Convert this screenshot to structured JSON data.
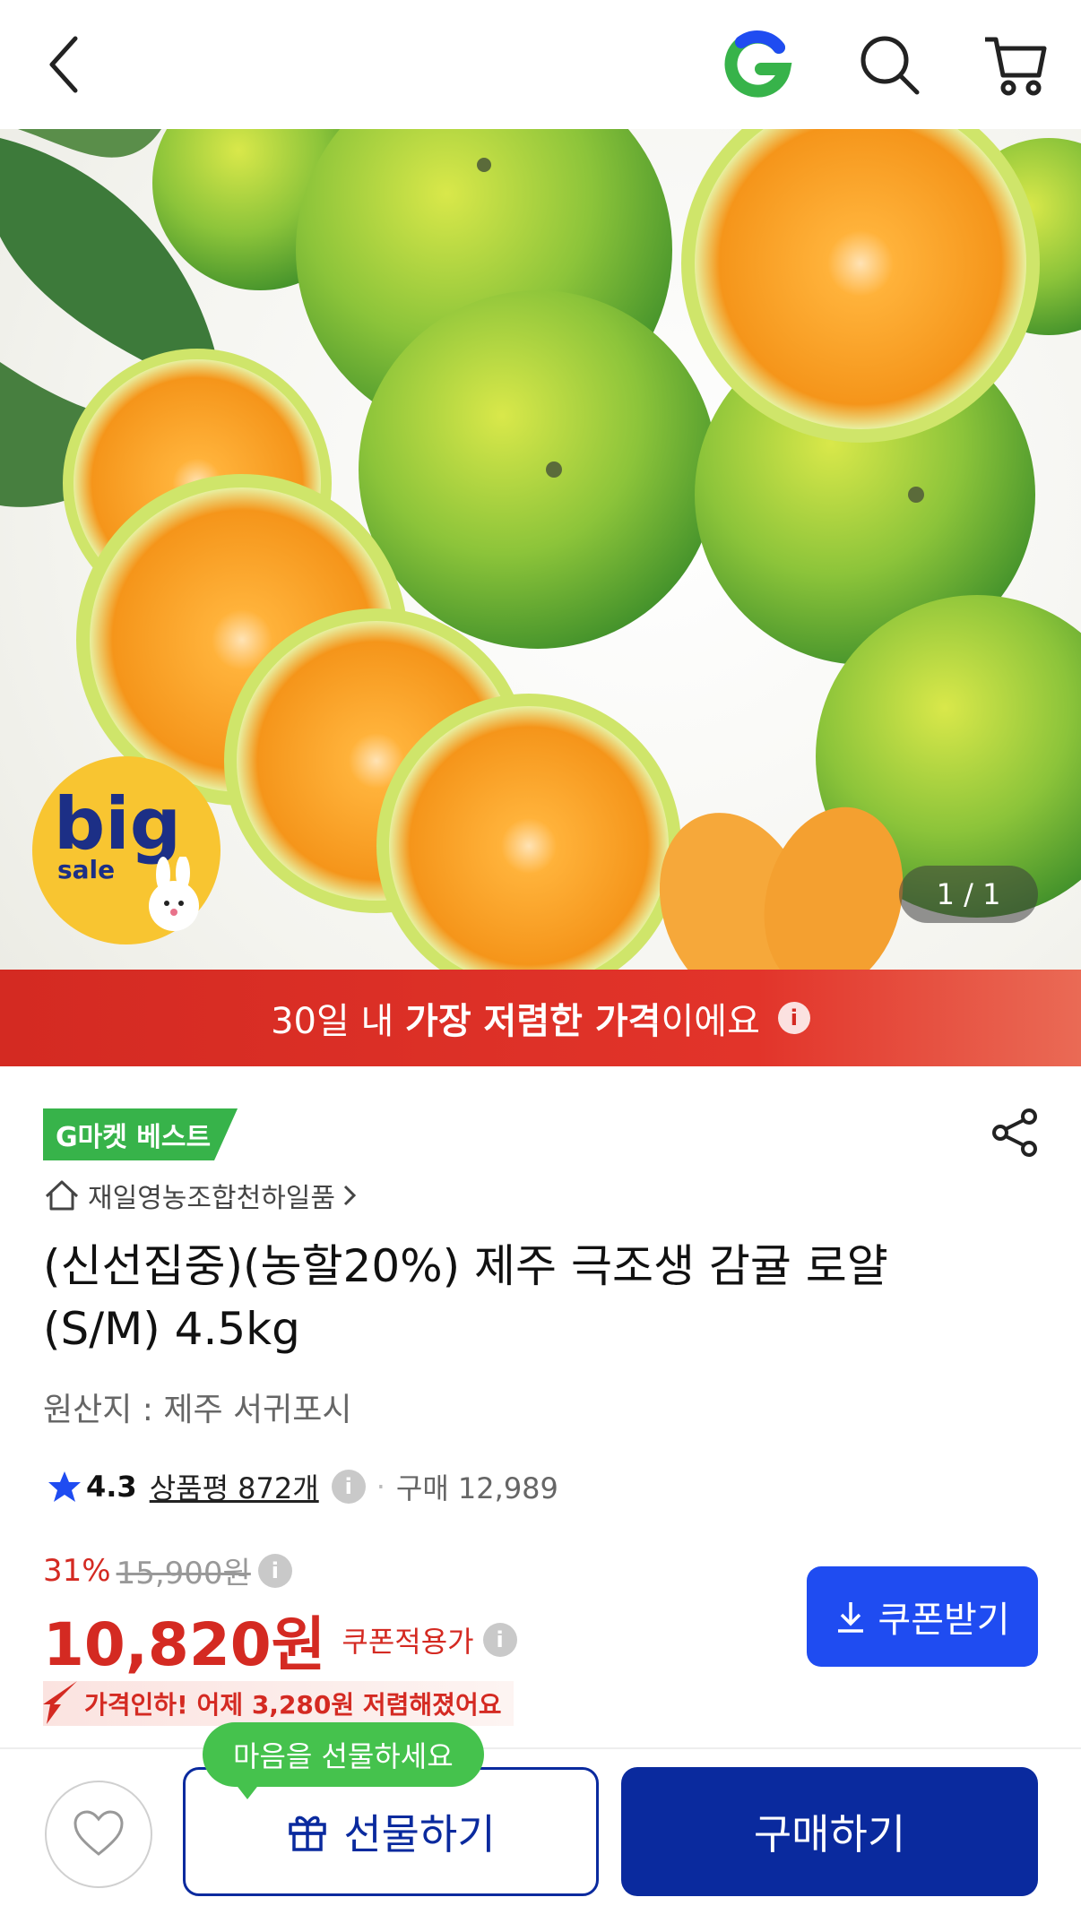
{
  "header": {
    "back_icon": "chevron-left-icon",
    "logo": "G",
    "search_icon": "search-icon",
    "cart_icon": "cart-icon"
  },
  "hero": {
    "counter": "1 / 1",
    "sticker_big": "big",
    "sticker_sale": "sale"
  },
  "banner": {
    "prefix": "30일 내 ",
    "highlight": "가장 저렴한 가격",
    "suffix": "이에요"
  },
  "product": {
    "badge": "G마켓 베스트",
    "seller": "재일영농조합천하일품",
    "title": "(신선집중)(농할20%) 제주 극조생 감귤 로얄(S/M) 4.5kg",
    "origin": "원산지 : 제주 서귀포시",
    "rating": "4.3",
    "review_link": "상품평 872개",
    "purchases": "구매 12,989"
  },
  "price": {
    "discount": "31%",
    "original": "15,900원",
    "final": "10,820원",
    "coupon_label": "쿠폰적용가",
    "coupon_button": "쿠폰받기",
    "drop_text": "가격인하! 어제 3,280원 저렴해졌어요"
  },
  "bottom": {
    "tooltip": "마음을 선물하세요",
    "gift_button": "선물하기",
    "buy_button": "구매하기"
  },
  "colors": {
    "red": "#d42a22",
    "navy": "#0a2a9e",
    "blue": "#1f4cf1",
    "green": "#37b34a"
  }
}
